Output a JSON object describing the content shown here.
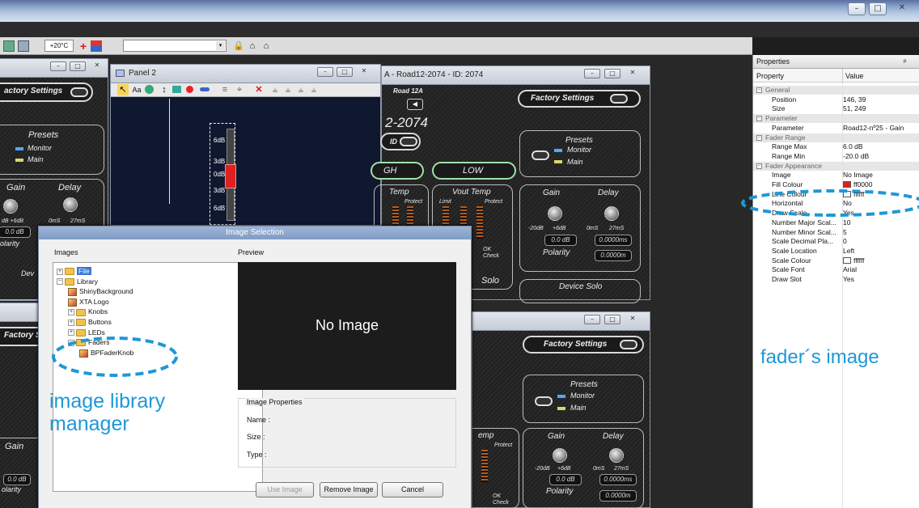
{
  "toolbar": {
    "temp_value": "+20°C"
  },
  "panel2": {
    "title": "Panel 2",
    "db_labels": [
      "6dB",
      "3dB",
      "0dB",
      "3dB",
      "6dB"
    ]
  },
  "device_top": {
    "title": "A - Road12-2074 - ID: 2074",
    "model": "Road 12A",
    "factory_settings": "Factory Settings",
    "id_partial": "2-2074",
    "id_label": "ID",
    "gh_label": "GH",
    "low_label": "LOW",
    "temp": "Temp",
    "protect": "Protect",
    "vout_temp": "Vout Temp",
    "limit": "Limit",
    "presets": "Presets",
    "monitor": "Monitor",
    "main": "Main",
    "gain": "Gain",
    "delay": "Delay",
    "gain_min": "-20dB",
    "gain_max": "+6dB",
    "delay_min": "0mS",
    "delay_max": "27mS",
    "gain_value": "0.0 dB",
    "delay_value": "0.0000ms",
    "polarity": "Polarity",
    "polarity_value": "0.0000m",
    "device_solo": "Device Solo",
    "solo": "Solo",
    "ok": "OK",
    "check": "Check"
  },
  "device_left": {
    "factory_settings": "actory Settings",
    "presets": "Presets",
    "monitor": "Monitor",
    "main": "Main",
    "gain": "Gain",
    "delay": "Delay",
    "scale_gain": "dB +6dB",
    "scale_delay_min": "0mS",
    "scale_delay_max": "27mS",
    "gain_value": "0.0 dB",
    "polarity": "olarity",
    "dev": "Dev"
  },
  "device_left_lower": {
    "factory_settings": "Factory S",
    "gain": "Gain",
    "scale_gain": "dB +6dB",
    "gain_value": "0.0 dB",
    "polarity": "olarity"
  },
  "device_bottom": {
    "factory_settings": "Factory Settings",
    "presets": "Presets",
    "monitor": "Monitor",
    "main": "Main",
    "gain": "Gain",
    "delay": "Delay",
    "temp": "emp",
    "protect": "Protect",
    "gain_min": "-20dB",
    "gain_max": "+6dB",
    "delay_min": "0mS",
    "delay_max": "27mS",
    "gain_value": "0.0 dB",
    "delay_value": "0.0000ms",
    "polarity": "Polarity",
    "polarity_value": "0.0000m",
    "ok": "OK",
    "check": "Check"
  },
  "dialog": {
    "title": "Image Selection",
    "images_label": "Images",
    "preview_label": "Preview",
    "no_image": "No Image",
    "image_properties": "Image Properties",
    "name_label": "Name :",
    "size_label": "Size :",
    "type_label": "Type :",
    "use_image": "Use Image",
    "remove_image": "Remove Image",
    "cancel": "Cancel",
    "tree": [
      {
        "label": "File",
        "depth": 0,
        "icon": "folder",
        "selected": true
      },
      {
        "label": "Library",
        "depth": 0,
        "icon": "folder"
      },
      {
        "label": "ShinyBackground",
        "depth": 1,
        "icon": "image"
      },
      {
        "label": "XTA Logo",
        "depth": 1,
        "icon": "image"
      },
      {
        "label": "Knobs",
        "depth": 1,
        "icon": "folder"
      },
      {
        "label": "Buttons",
        "depth": 1,
        "icon": "folder"
      },
      {
        "label": "LEDs",
        "depth": 1,
        "icon": "folder"
      },
      {
        "label": "Faders",
        "depth": 1,
        "icon": "folder"
      },
      {
        "label": "BPFaderKnob",
        "depth": 2,
        "icon": "image"
      }
    ]
  },
  "properties": {
    "title": "Properties",
    "pin": "ᵖ",
    "col_property": "Property",
    "col_value": "Value",
    "rows": [
      {
        "type": "cat",
        "label": "General"
      },
      {
        "type": "row",
        "key": "Position",
        "value": "146, 39"
      },
      {
        "type": "row",
        "key": "Size",
        "value": "51, 249"
      },
      {
        "type": "cat",
        "label": "Parameter"
      },
      {
        "type": "row",
        "key": "Parameter",
        "value": "Road12-nº25 - Gain"
      },
      {
        "type": "cat",
        "label": "Fader Range"
      },
      {
        "type": "row",
        "key": "Range Max",
        "value": "6.0 dB"
      },
      {
        "type": "row",
        "key": "Range Min",
        "value": "-20.0 dB"
      },
      {
        "type": "cat",
        "label": "Fader Appearance"
      },
      {
        "type": "row",
        "key": "Image",
        "value": "No Image"
      },
      {
        "type": "row",
        "key": "Fill Colour",
        "value": "ff0000",
        "swatch": "#e02020"
      },
      {
        "type": "row",
        "key": "Line Colour",
        "value": "ffffff",
        "swatch": "#ffffff"
      },
      {
        "type": "row",
        "key": "Horizontal",
        "value": "No"
      },
      {
        "type": "row",
        "key": "Draw Scale",
        "value": "Yes"
      },
      {
        "type": "row",
        "key": "Number Major Scal...",
        "value": "10"
      },
      {
        "type": "row",
        "key": "Number Minor Scal...",
        "value": "5"
      },
      {
        "type": "row",
        "key": "Scale Decimal Pla...",
        "value": "0"
      },
      {
        "type": "row",
        "key": "Scale Location",
        "value": "Left"
      },
      {
        "type": "row",
        "key": "Scale Colour",
        "value": "ffffff",
        "swatch": "#ffffff"
      },
      {
        "type": "row",
        "key": "Scale Font",
        "value": "Arial"
      },
      {
        "type": "row",
        "key": "Draw Slot",
        "value": "Yes"
      }
    ]
  },
  "annotations": {
    "library_line1": "image library",
    "library_line2": "manager",
    "fader_image": "fader´s image"
  },
  "colors": {
    "accent_annotation": "#1e98d6",
    "fader_fill": "#e02020",
    "green_pill": "#9fe0a7"
  },
  "icons": [
    "minimize-icon",
    "maximize-icon",
    "close-icon",
    "folder-icon",
    "image-file-icon",
    "expand-icon",
    "pointer-icon",
    "text-tool-icon",
    "knob-tool-icon",
    "fader-tool-icon",
    "delete-icon"
  ]
}
